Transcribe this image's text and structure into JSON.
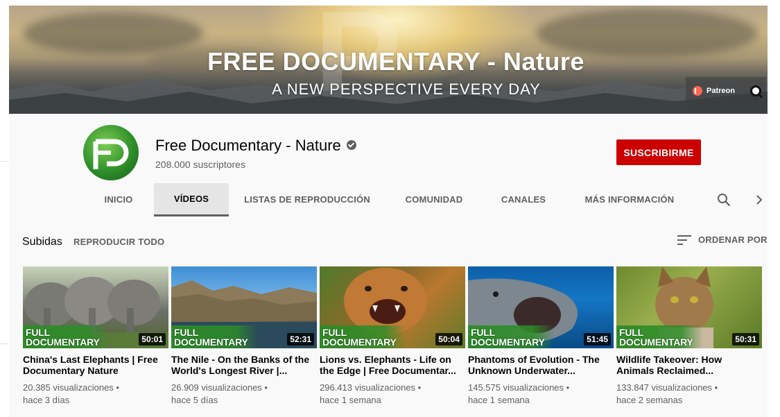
{
  "banner": {
    "title": "FREE DOCUMENTARY - Nature",
    "subtitle": "A NEW PERSPECTIVE EVERY DAY",
    "patreon_label": "Patreon"
  },
  "channel": {
    "name": "Free Documentary - Nature",
    "subscribers": "208.000 suscriptores",
    "subscribe_label": "SUSCRIBIRME"
  },
  "tabs": [
    {
      "label": "INICIO"
    },
    {
      "label": "VÍDEOS"
    },
    {
      "label": "LISTAS DE REPRODUCCIÓN"
    },
    {
      "label": "COMUNIDAD"
    },
    {
      "label": "CANALES"
    },
    {
      "label": "MÁS INFORMACIÓN"
    }
  ],
  "section": {
    "title": "Subidas",
    "play_all": "REPRODUCIR TODO",
    "sort_label": "ORDENAR POR"
  },
  "thumb_badge": [
    "FULL",
    "DOCUMENTARY"
  ],
  "videos": [
    {
      "title": "China's Last Elephants | Free Documentary Nature",
      "views": "20.385 visualizaciones •",
      "age": "hace 3 días",
      "duration": "50:01"
    },
    {
      "title": "The Nile - On the Banks of the World's Longest River |...",
      "views": "26.909 visualizaciones •",
      "age": "hace 5 días",
      "duration": "52:31"
    },
    {
      "title": "Lions vs. Elephants - Life on the Edge | Free Documentar...",
      "views": "296.413 visualizaciones •",
      "age": "hace 1 semana",
      "duration": "50:04"
    },
    {
      "title": "Phantoms of Evolution - The Unknown Underwater...",
      "views": "145.575 visualizaciones •",
      "age": "hace 1 semana",
      "duration": "51:45"
    },
    {
      "title": "Wildlife Takeover: How Animals Reclaimed...",
      "views": "133.847 visualizaciones •",
      "age": "hace 2 semanas",
      "duration": "50:31"
    }
  ]
}
